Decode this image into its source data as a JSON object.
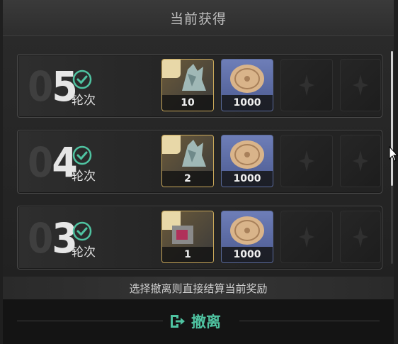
{
  "header": {
    "title": "当前获得"
  },
  "rounds": [
    {
      "digit0": "0",
      "digit1": "5",
      "label": "轮次",
      "rewards": [
        {
          "kind": "gold",
          "count": "10"
        },
        {
          "kind": "coin",
          "count": "1000"
        }
      ]
    },
    {
      "digit0": "0",
      "digit1": "4",
      "label": "轮次",
      "rewards": [
        {
          "kind": "gold",
          "count": "2"
        },
        {
          "kind": "coin",
          "count": "1000"
        }
      ]
    },
    {
      "digit0": "0",
      "digit1": "3",
      "label": "轮次",
      "rewards": [
        {
          "kind": "gold",
          "count": "1"
        },
        {
          "kind": "coin",
          "count": "1000"
        }
      ]
    }
  ],
  "hint": "选择撤离则直接结算当前奖励",
  "footer": {
    "withdraw_label": "撤离"
  },
  "colors": {
    "accent": "#4fc3a1",
    "gold_frame": "#c9a85a",
    "coin_bg": "#5b6aa4"
  },
  "icons": {
    "check": "check-circle-icon",
    "exit": "exit-icon",
    "empty": "empty-slot-icon"
  }
}
